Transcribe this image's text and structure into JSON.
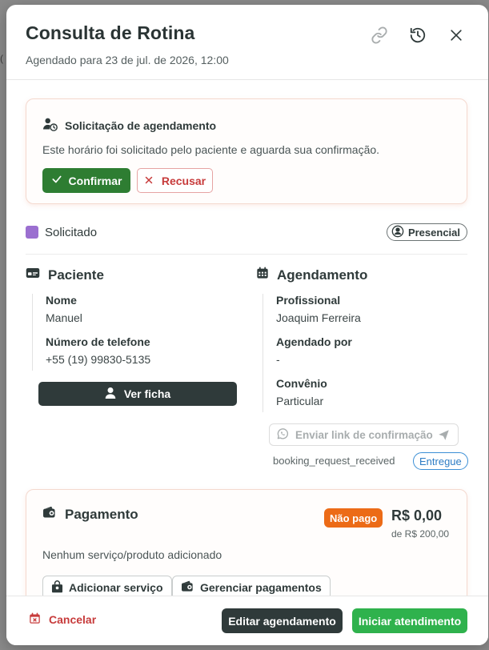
{
  "modal": {
    "title": "Consulta de Rotina",
    "subtitle": "Agendado para 23 de jul. de 2026, 12:00"
  },
  "request": {
    "title": "Solicitação de agendamento",
    "text": "Este horário foi solicitado pelo paciente e aguarda sua confirmação.",
    "confirm_label": "Confirmar",
    "refuse_label": "Recusar"
  },
  "status": {
    "label": "Solicitado",
    "color": "#9b6fd0",
    "modality": "Presencial"
  },
  "patient": {
    "title": "Paciente",
    "name_label": "Nome",
    "name": "Manuel",
    "phone_label": "Número de telefone",
    "phone": "+55 (19) 99830-5135",
    "record_button": "Ver ficha"
  },
  "schedule": {
    "title": "Agendamento",
    "professional_label": "Profissional",
    "professional": "Joaquim Ferreira",
    "scheduled_by_label": "Agendado por",
    "scheduled_by": "-",
    "insurance_label": "Convênio",
    "insurance": "Particular",
    "whatsapp_button": "Enviar link de confirmação",
    "message_status": "booking_request_received",
    "message_badge": "Entregue"
  },
  "payment": {
    "title": "Pagamento",
    "status_badge": "Não pago",
    "amount": "R$ 0,00",
    "total": "de R$ 200,00",
    "empty_text": "Nenhum serviço/produto adicionado",
    "add_service_button": "Adicionar serviço",
    "manage_payments_button": "Gerenciar pagamentos"
  },
  "footer": {
    "cancel_label": "Cancelar",
    "edit_label": "Editar agendamento",
    "start_label": "Iniciar atendimento"
  },
  "colors": {
    "confirm": "#2e7d32",
    "danger": "#c73b3b",
    "unpaid": "#ec6b17",
    "start": "#2fb24d",
    "dark": "#2f3a3a",
    "delivered": "#3b8fd6"
  }
}
